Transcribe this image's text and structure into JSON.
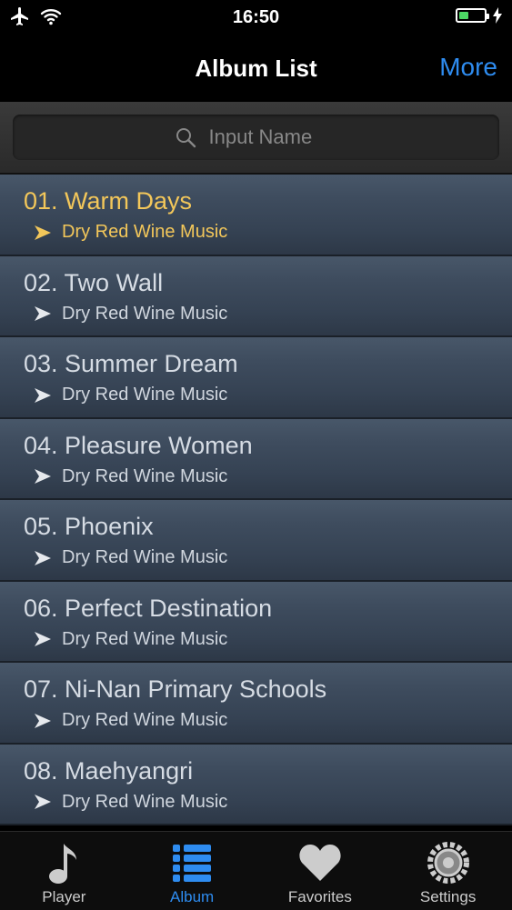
{
  "status": {
    "time": "16:50",
    "icons": [
      "airplane-icon",
      "wifi-icon",
      "battery-icon",
      "charging-icon"
    ]
  },
  "nav": {
    "title": "Album List",
    "more": "More"
  },
  "search": {
    "placeholder": "Input Name"
  },
  "albums": [
    {
      "name": "01. Warm Days",
      "artist": "Dry Red Wine Music",
      "active": true
    },
    {
      "name": "02. Two Wall",
      "artist": "Dry Red Wine Music"
    },
    {
      "name": "03. Summer Dream",
      "artist": "Dry Red Wine Music"
    },
    {
      "name": "04. Pleasure Women",
      "artist": "Dry Red Wine Music"
    },
    {
      "name": "05. Phoenix",
      "artist": "Dry Red Wine Music"
    },
    {
      "name": "06. Perfect Destination",
      "artist": "Dry Red Wine Music"
    },
    {
      "name": "07. Ni-Nan Primary Schools",
      "artist": "Dry Red Wine Music"
    },
    {
      "name": "08. Maehyangri",
      "artist": "Dry Red Wine Music"
    }
  ],
  "tabs": [
    {
      "label": "Player",
      "icon": "music-note-icon"
    },
    {
      "label": "Album",
      "icon": "list-icon",
      "active": true
    },
    {
      "label": "Favorites",
      "icon": "heart-icon"
    },
    {
      "label": "Settings",
      "icon": "gear-icon"
    }
  ],
  "colors": {
    "accent": "#2e8cf0",
    "active_row": "#f3c75a",
    "battery": "#4cd964"
  }
}
